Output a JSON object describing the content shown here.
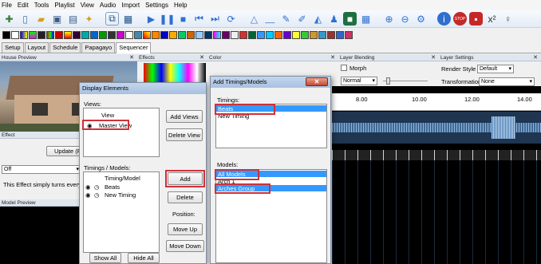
{
  "menu": {
    "items": [
      "File",
      "Edit",
      "Tools",
      "Playlist",
      "View",
      "Audio",
      "Import",
      "Settings",
      "Help"
    ]
  },
  "tabs": [
    {
      "label": "Setup"
    },
    {
      "label": "Layout"
    },
    {
      "label": "Schedule"
    },
    {
      "label": "Papagayo"
    },
    {
      "label": "Sequencer"
    }
  ],
  "panels": {
    "house_preview": "House Preview",
    "effects": "Effects",
    "color": "Color",
    "layer_blending": "Layer Blending",
    "layer_settings": "Layer Settings",
    "effect": "Effect",
    "model_preview": "Model Preview"
  },
  "effect_panel": {
    "update_button": "Update (F5)",
    "dropdown_value": "Off",
    "description": "This Effect simply turns every"
  },
  "layer_blending": {
    "morph_label": "Morph",
    "mode_value": "Normal"
  },
  "layer_settings": {
    "render_style_label": "Render Style",
    "render_style_value": "Default",
    "transformation_label": "Transformation",
    "transformation_value": "None"
  },
  "timeline": {
    "ticks": [
      "8.00",
      "10.00",
      "12.00",
      "14.00"
    ]
  },
  "display_elements": {
    "title": "Display Elements",
    "views_label": "Views:",
    "views_col": "View",
    "views": [
      "Master View"
    ],
    "add_views": "Add Views",
    "delete_view": "Delete View",
    "timing_models_label": "Timings / Models:",
    "timing_col": "Timing/Model",
    "timings": [
      "Beats",
      "New Timing"
    ],
    "add": "Add",
    "delete": "Delete",
    "position_label": "Position:",
    "move_up": "Move Up",
    "move_down": "Move Down",
    "show_all": "Show All",
    "hide_all": "Hide All"
  },
  "add_dialog": {
    "title": "Add Timings/Models",
    "timings_label": "Timings:",
    "timings": [
      "Beats",
      "New Timing"
    ],
    "models_label": "Models:",
    "models": [
      "All Models",
      "Arch 1",
      "Arches Group"
    ]
  },
  "colors": {
    "selection": "#3399ff",
    "highlight_box": "#d0303a"
  }
}
